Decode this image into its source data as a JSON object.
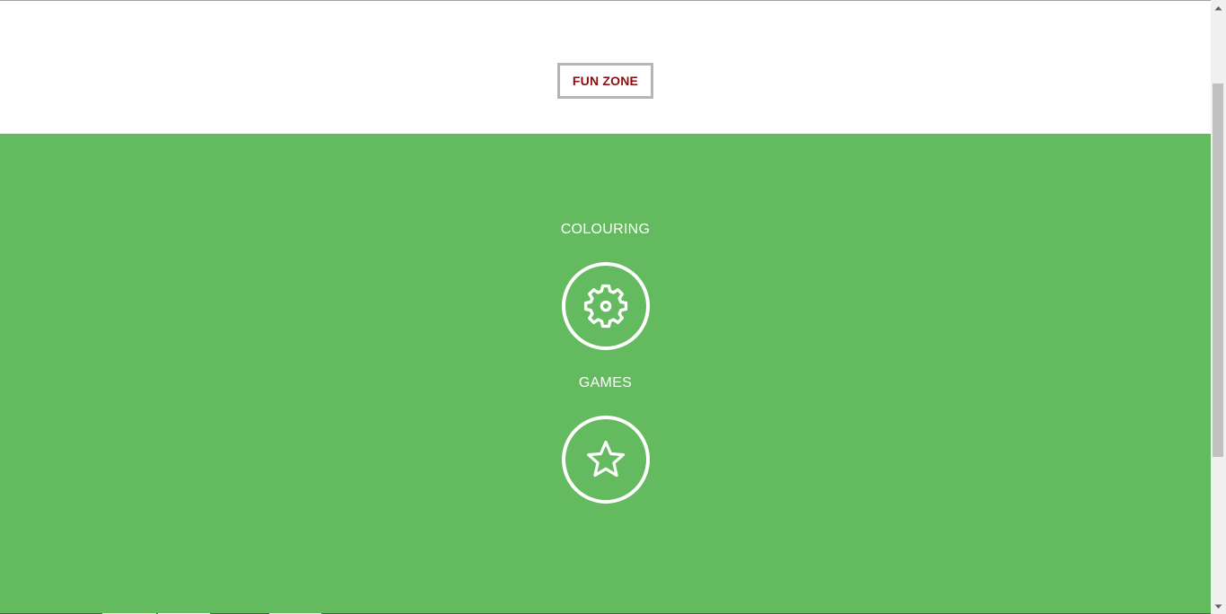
{
  "header": {
    "fun_zone_label": "FUN ZONE"
  },
  "fun_zone": {
    "background_color": "#64ba5f",
    "items": [
      {
        "label": "COLOURING",
        "icon": "gear-icon"
      },
      {
        "label": "GAMES",
        "icon": "star-icon"
      }
    ]
  },
  "colors": {
    "button_text": "#8b0e0e",
    "button_border": "#b5b5b5",
    "icon_color": "#ffffff"
  }
}
